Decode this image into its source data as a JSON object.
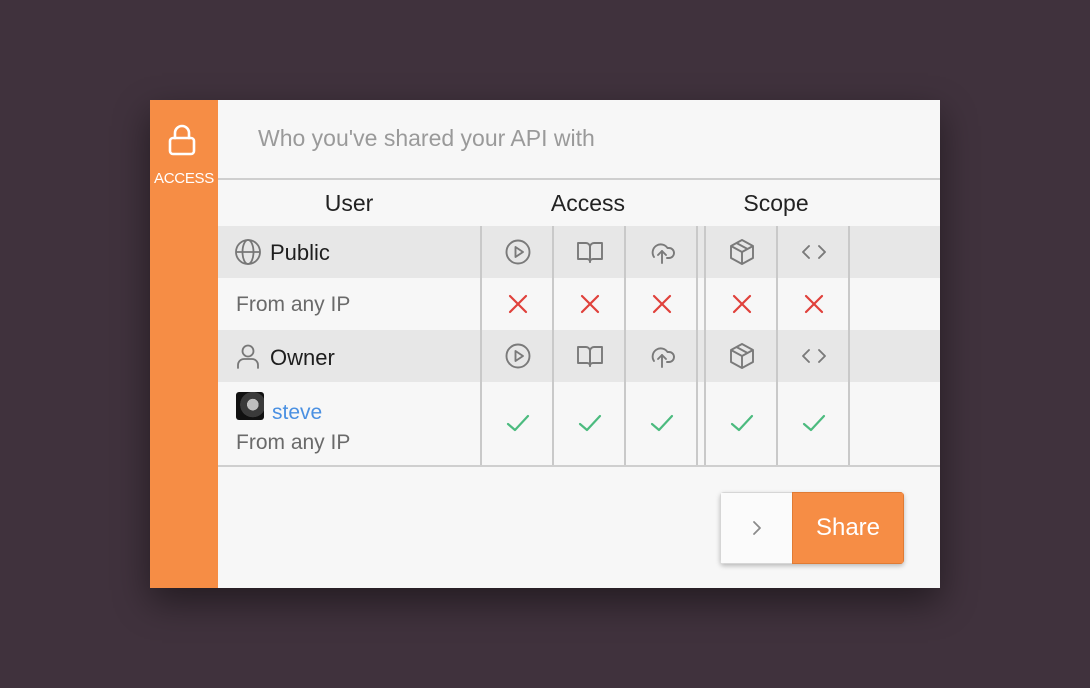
{
  "sidebar": {
    "icon": "lock-icon",
    "label": "ACCESS",
    "color": "#f68d45"
  },
  "subtitle": "Who you've shared your API with",
  "columns": {
    "user": "User",
    "access": "Access",
    "scope": "Scope"
  },
  "permission_icons": {
    "access": [
      "play-icon",
      "book-icon",
      "upload-cloud-icon"
    ],
    "scope": [
      "package-icon",
      "code-icon"
    ]
  },
  "rows": [
    {
      "type": "group",
      "icon": "globe-icon",
      "label": "Public"
    },
    {
      "type": "entry",
      "sub": "From any IP",
      "permissions": [
        false,
        false,
        false,
        false,
        false
      ]
    },
    {
      "type": "group",
      "icon": "user-icon",
      "label": "Owner"
    },
    {
      "type": "entry",
      "user": "steve",
      "sub": "From any IP",
      "permissions": [
        true,
        true,
        true,
        true,
        true
      ]
    }
  ],
  "share": {
    "expand_icon": "chevron-right-icon",
    "label": "Share"
  },
  "colors": {
    "accent": "#f68d45",
    "deny": "#e0413b",
    "allow": "#4cbb7f",
    "link": "#4a90e2"
  }
}
